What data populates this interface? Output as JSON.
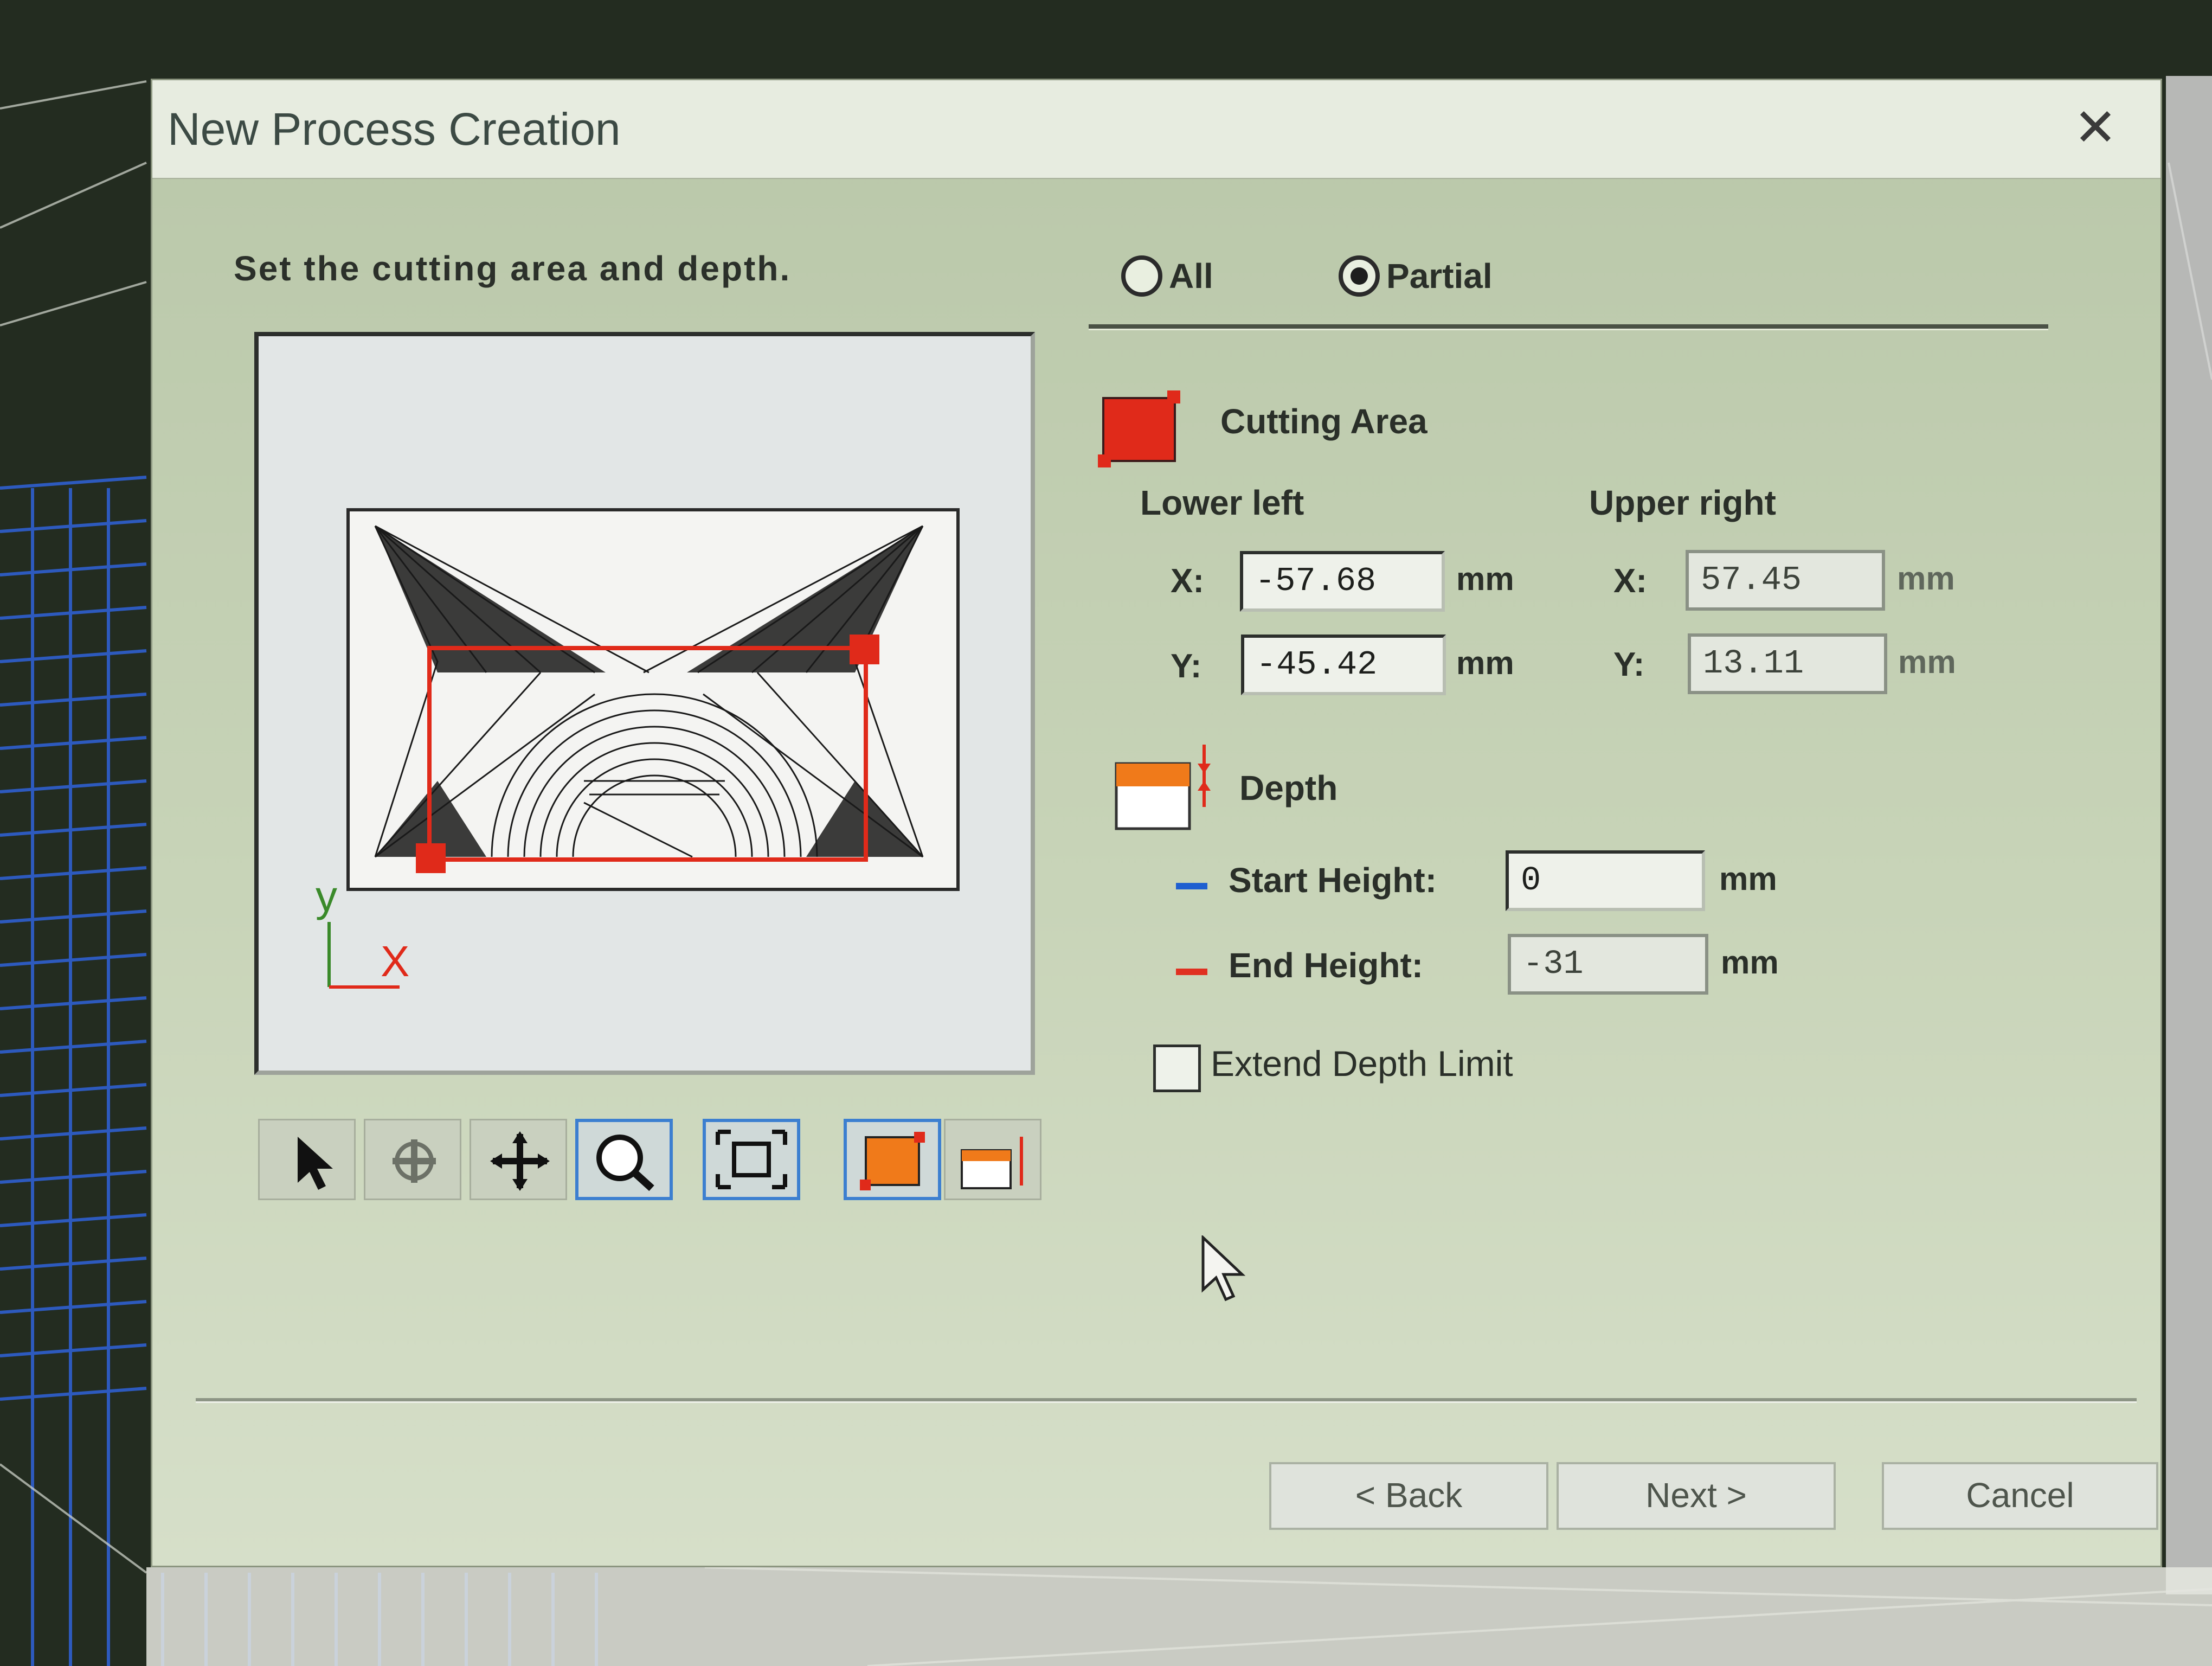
{
  "window": {
    "title": "New Process Creation",
    "close_glyph": "✕"
  },
  "instruction": "Set the cutting area and depth.",
  "mode": {
    "options": [
      {
        "label": "All",
        "selected": false
      },
      {
        "label": "Partial",
        "selected": true
      }
    ]
  },
  "preview": {
    "axis_y": "y",
    "axis_x": "X"
  },
  "toolbar": {
    "tools": [
      {
        "icon": "select-arrow-icon",
        "active": false
      },
      {
        "icon": "rotate-view-icon",
        "active": false
      },
      {
        "icon": "pan-icon",
        "active": false
      },
      {
        "icon": "zoom-icon",
        "active": true
      },
      {
        "icon": "fit-view-icon",
        "active": true
      },
      {
        "icon": "cutting-area-icon",
        "active": true
      },
      {
        "icon": "depth-icon",
        "active": false
      }
    ]
  },
  "cutting_area": {
    "label": "Cutting Area",
    "lower_left": {
      "heading": "Lower left",
      "x_label": "X:",
      "x_value": "-57.68",
      "y_label": "Y:",
      "y_value": "-45.42",
      "unit": "mm"
    },
    "upper_right": {
      "heading": "Upper right",
      "x_label": "X:",
      "x_value": "57.45",
      "y_label": "Y:",
      "y_value": "13.11",
      "unit": "mm"
    }
  },
  "depth": {
    "label": "Depth",
    "start_height": {
      "label": "Start Height:",
      "value": "0",
      "unit": "mm",
      "color": "#1f5fd0"
    },
    "end_height": {
      "label": "End Height:",
      "value": "-31",
      "unit": "mm",
      "color": "#e03020"
    },
    "extend_limit": {
      "label": "Extend Depth Limit",
      "checked": false
    }
  },
  "buttons": {
    "back": "< Back",
    "next": "Next >",
    "cancel": "Cancel"
  },
  "colors": {
    "accent": "#3c7fd0",
    "area_red": "#e02a1a",
    "dialog_bg": "#c8d4b8"
  }
}
